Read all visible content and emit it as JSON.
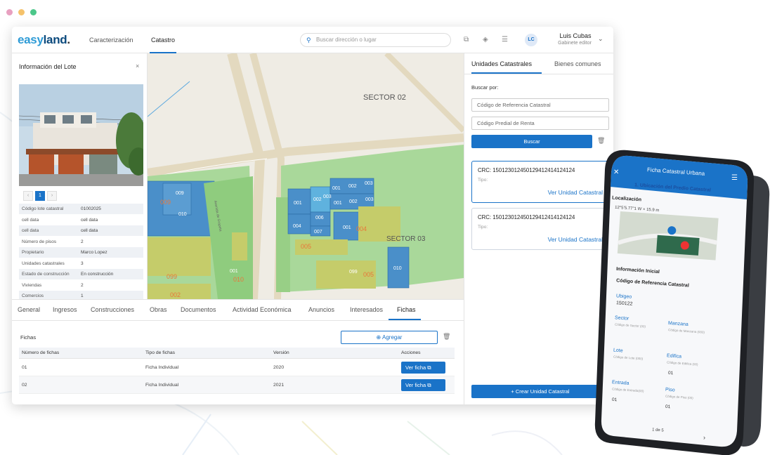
{
  "window_dots": [
    "#e8a0c0",
    "#f5c26b",
    "#4cc78a"
  ],
  "logo": {
    "part1": "easy",
    "part2": "land",
    "part3": "."
  },
  "nav": {
    "caracterizacion": "Caracterización",
    "catastro": "Catastro"
  },
  "search": {
    "placeholder": "Buscar dirección o lugar"
  },
  "user": {
    "initials": "LC",
    "name": "Luis Cubas",
    "role": "Gabinete editor"
  },
  "lote": {
    "title": "Información del Lote",
    "close": "×",
    "pager": [
      "‹",
      "1",
      "›"
    ],
    "attributes": [
      {
        "k": "Código lote catastral",
        "v": "01002025"
      },
      {
        "k": "cell data",
        "v": "cell data"
      },
      {
        "k": "cell data",
        "v": "cell data"
      },
      {
        "k": "Número de pisos",
        "v": "2"
      },
      {
        "k": "Propietario",
        "v": "Marco Lopez"
      },
      {
        "k": "Unidades catastrales",
        "v": "3"
      },
      {
        "k": "Estado de construcción",
        "v": "En construcción"
      },
      {
        "k": "Viviendas",
        "v": "2"
      },
      {
        "k": "Comercios",
        "v": "1"
      }
    ]
  },
  "map": {
    "sector02": "SECTOR 02",
    "sector03": "SECTOR 03",
    "street": "Avenida de Grapeta",
    "lots_blue": [
      "001",
      "002",
      "003",
      "001",
      "002",
      "003",
      "001",
      "002",
      "003",
      "006",
      "004",
      "007",
      "001",
      "009",
      "010",
      "010",
      "001",
      "099"
    ],
    "lots_orange": [
      "009",
      "004",
      "005",
      "099",
      "010",
      "005",
      "002"
    ]
  },
  "right_panel": {
    "tabs": [
      "Unidades Catastrales",
      "Bienes comunes"
    ],
    "buscar_por": "Buscar por:",
    "input1": "Código de Referencia Catastral",
    "input2": "Código Predial de Renta",
    "buscar_btn": "Buscar",
    "cards": [
      {
        "crc": "CRC: 15012301245012941241412412​4",
        "tipo": "Tipo:",
        "link": "Ver Unidad Catastral"
      },
      {
        "crc": "CRC: 15012301245012941241412412​4",
        "tipo": "Tipo:",
        "link": "Ver Unidad Catastral"
      }
    ],
    "crear_btn": "+  Crear Unidad Catastral"
  },
  "bottom": {
    "tabs": [
      "General",
      "Ingresos",
      "Construcciones",
      "Obras",
      "Documentos",
      "Actividad Económica",
      "Anuncios",
      "Interesados",
      "Fichas"
    ],
    "fichas_label": "Fichas",
    "agregar": "⊕  Agregar",
    "headers": [
      "Número de fichas",
      "Tipo de fichas",
      "Versión",
      "Acciones"
    ],
    "rows": [
      {
        "num": "01",
        "tipo": "Ficha Individual",
        "version": "2020",
        "btn": "Ver ficha  ⧉"
      },
      {
        "num": "02",
        "tipo": "Ficha Individual",
        "version": "2021",
        "btn": "Ver ficha  ⧉"
      }
    ]
  },
  "phone": {
    "header": "Ficha Catastral Urbana",
    "section": "1. Ubicación del Predio Catastral",
    "localizacion": "Localización",
    "coords": "12°5’5.77\"1 W × 15.9 m",
    "info_inicial": "Información Inicial",
    "codigo_ref": "Código de Referencia Catastral",
    "ubigeo_label": "Ubigeo",
    "ubigeo_value": "150122",
    "sector": "Sector",
    "sector_hint": "Código de Sector (00)",
    "manzana": "Manzana",
    "manzana_hint": "Código de Manzana (000)",
    "lote": "Lote",
    "lote_hint": "Código de Lote (000)",
    "edifica": "Edifica",
    "edifica_hint": "Código de Edifica (00)",
    "edifica_value": "01",
    "entrada": "Entrada",
    "entrada_hint": "Código de Entrada(00)",
    "entrada_value": "01",
    "piso": "Piso",
    "piso_hint": "Código de Piso (00)",
    "piso_value": "01",
    "pager": "1 de 5"
  },
  "colors": {
    "primary": "#1a73c8",
    "lot_blue": "#4a8fc9",
    "lot_orange": "#e8773a",
    "green": "#9fd08a",
    "olive": "#c5cc6a"
  }
}
